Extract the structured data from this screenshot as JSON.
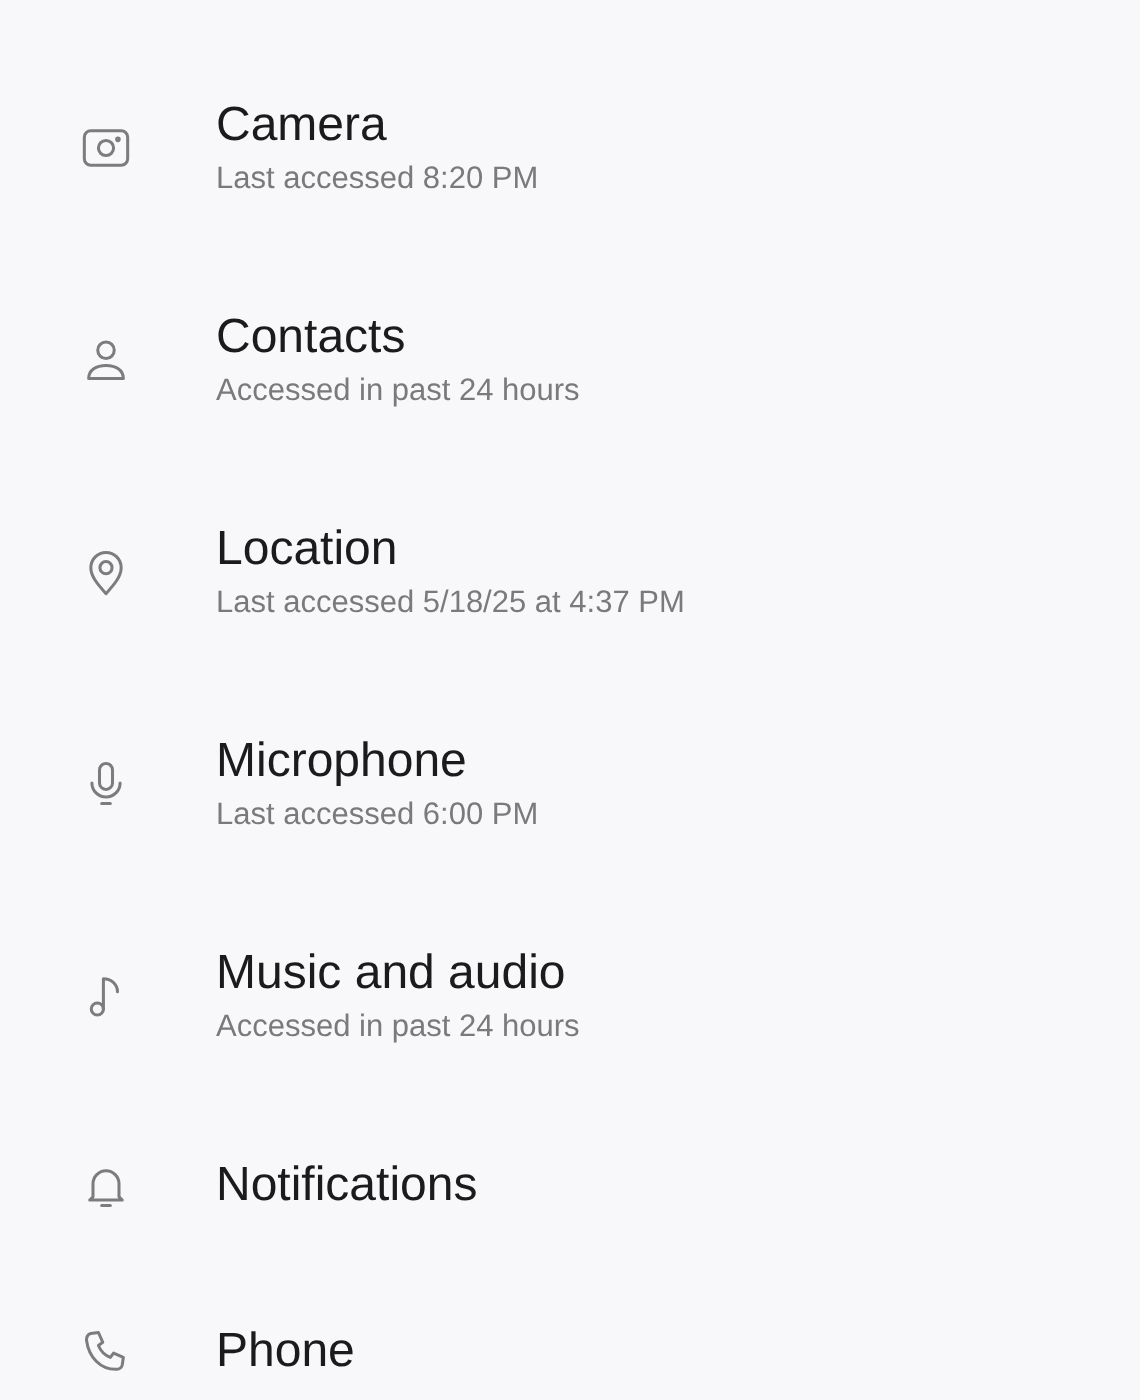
{
  "permissions": [
    {
      "kind": "camera",
      "name": "Camera",
      "detail": "Last accessed 8:20 PM"
    },
    {
      "kind": "contacts",
      "name": "Contacts",
      "detail": "Accessed in past 24 hours"
    },
    {
      "kind": "location",
      "name": "Location",
      "detail": "Last accessed 5/18/25 at 4:37 PM"
    },
    {
      "kind": "microphone",
      "name": "Microphone",
      "detail": "Last accessed 6:00 PM"
    },
    {
      "kind": "music",
      "name": "Music and audio",
      "detail": "Accessed in past 24 hours"
    },
    {
      "kind": "notifications",
      "name": "Notifications"
    },
    {
      "kind": "phone",
      "name": "Phone"
    }
  ]
}
